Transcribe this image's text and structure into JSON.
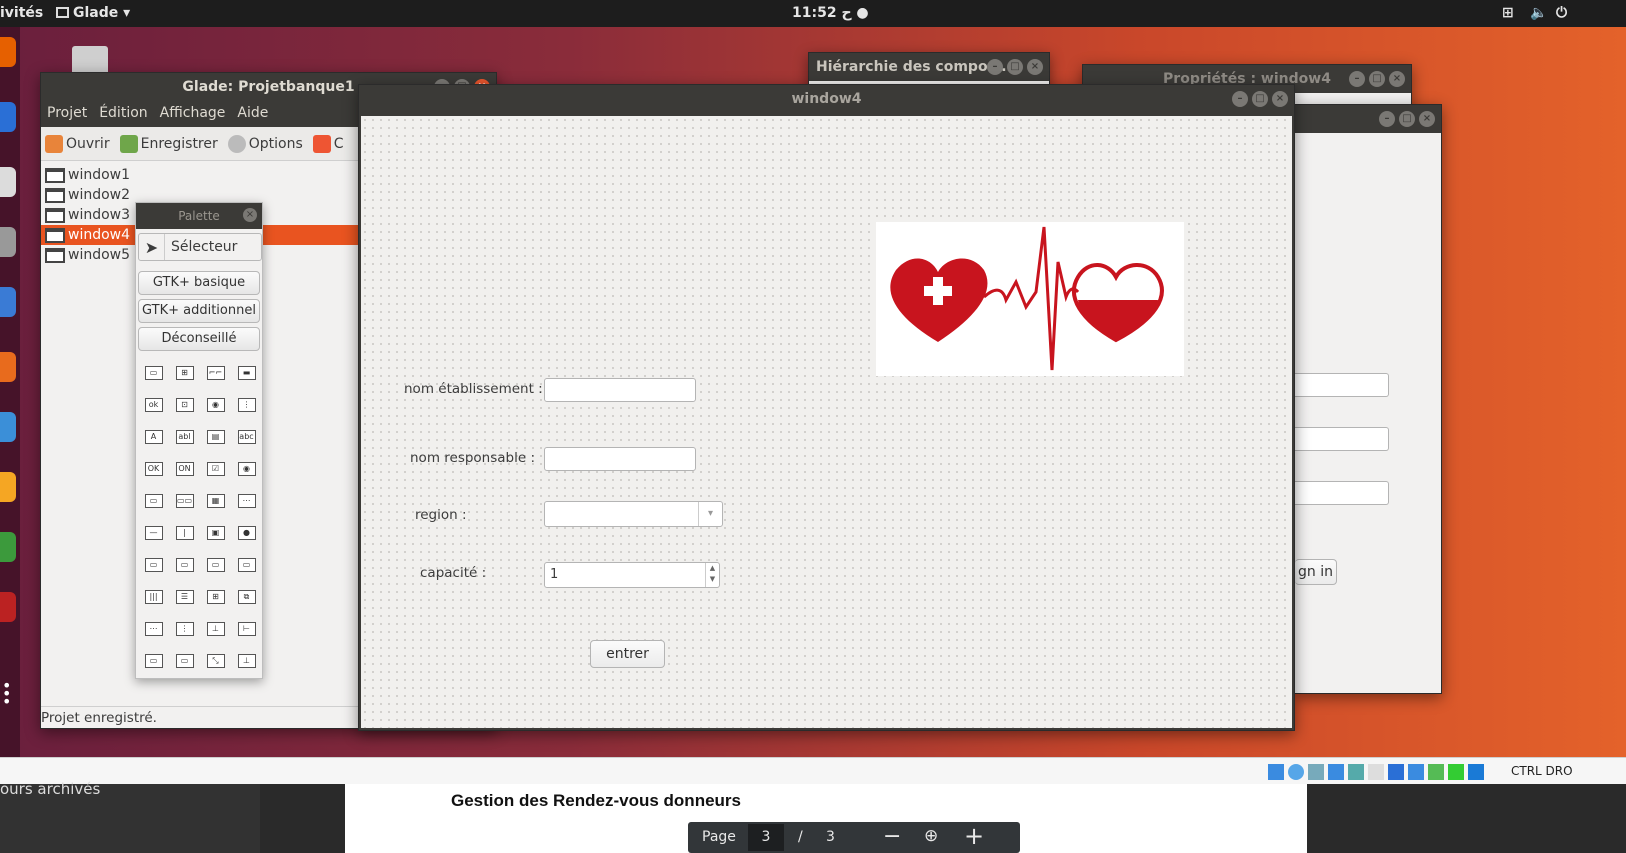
{
  "topbar": {
    "activities": "ivités",
    "app": "Glade",
    "clock": "11:52 ح"
  },
  "glade_main": {
    "title": "Glade: Projetbanque1",
    "menu": [
      "Projet",
      "Édition",
      "Affichage",
      "Aide"
    ],
    "toolbar": {
      "open": "Ouvrir",
      "save": "Enregistrer",
      "options": "Options",
      "extra": "C"
    },
    "windows": [
      "window1",
      "window2",
      "window3",
      "window4",
      "window5"
    ],
    "selected": "window4",
    "status": "Projet enregistré."
  },
  "palette": {
    "title": "Palette",
    "selector": "Sélecteur",
    "groups": [
      "GTK+ basique",
      "GTK+ additionnel",
      "Déconseillé"
    ],
    "widget_glyphs": [
      "▭",
      "⊞",
      "⌐⌐",
      "▬",
      "ok",
      "⊡",
      "◉",
      "⋮",
      "A",
      "abl",
      "▤",
      "abc",
      "OK",
      "ON",
      "☑",
      "◉",
      "▭",
      "▭▭",
      "▦",
      "⋯",
      "—",
      "|",
      "▣",
      "●",
      "▭",
      "▭",
      "▭",
      "▭",
      "|||",
      "☰",
      "⊞",
      "⧉",
      "⋯",
      "⋮",
      "⊥",
      "⊢",
      "▭",
      "▭",
      "⤡",
      "⊥"
    ]
  },
  "hierarchy_window": {
    "title": "Hiérarchie des compos..."
  },
  "props_window": {
    "title": "Propriétés : window4",
    "signin_partial": "gn in"
  },
  "window4": {
    "title": "window4",
    "form": {
      "etab_label": "nom établissement :",
      "resp_label": "nom responsable :",
      "region_label": "region :",
      "cap_label": "capacité :",
      "cap_value": "1",
      "submit": "entrer"
    }
  },
  "vbox_bar": {
    "text": "CTRL DRO"
  },
  "pdf": {
    "heading": "Gestion des Rendez-vous donneurs",
    "left_text": "ours archivés",
    "page_label": "Page",
    "page_current": "3",
    "page_sep": "/",
    "page_total": "3"
  },
  "colors": {
    "accent": "#e95420",
    "titlebar": "#3b3a37",
    "heart": "#c8141e"
  }
}
